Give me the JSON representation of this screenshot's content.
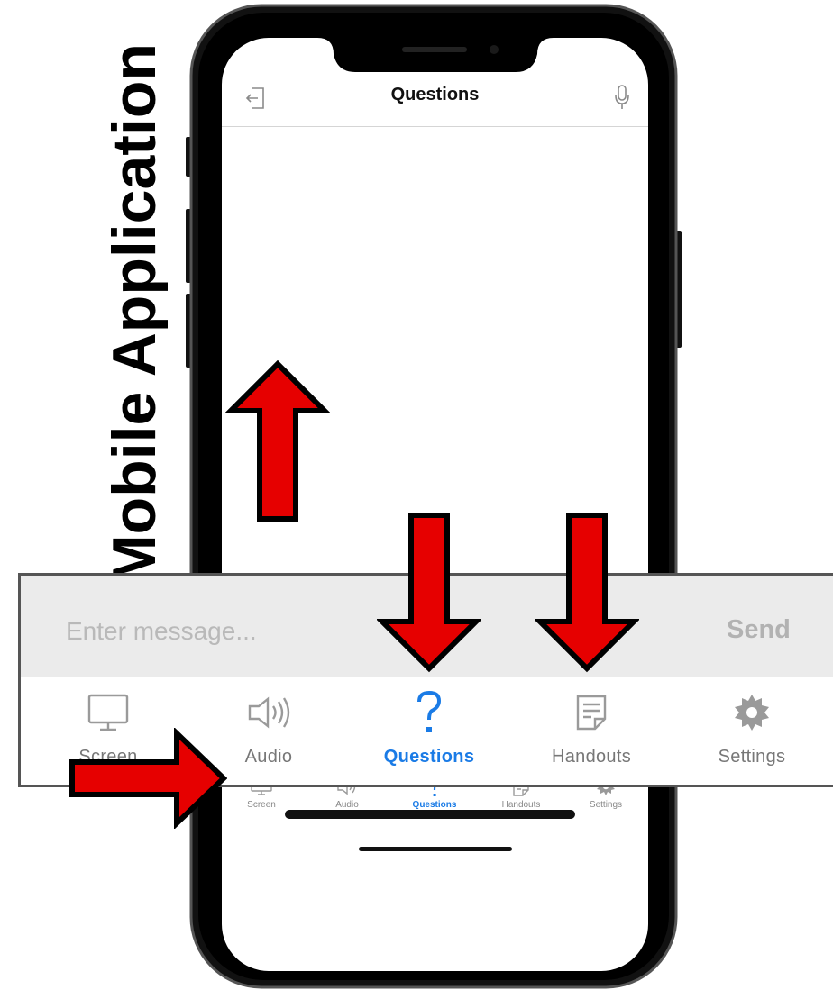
{
  "side_title": "Mobile Application",
  "app": {
    "title": "Questions",
    "header_left_icon": "exit-icon",
    "header_right_icon": "microphone-icon"
  },
  "composer": {
    "placeholder": "Enter message...",
    "send_label": "Send"
  },
  "tabs": [
    {
      "label": "Screen",
      "icon": "monitor-icon",
      "active": false
    },
    {
      "label": "Audio",
      "icon": "speaker-icon",
      "active": false
    },
    {
      "label": "Questions",
      "icon": "question-mark-icon",
      "active": true
    },
    {
      "label": "Handouts",
      "icon": "document-icon",
      "active": false
    },
    {
      "label": "Settings",
      "icon": "gear-icon",
      "active": false
    }
  ],
  "colors": {
    "active_tab": "#1a7be6",
    "inactive_tab": "#777777",
    "arrow_fill": "#e60000",
    "arrow_outline": "#000000",
    "composer_bg": "#ebebeb"
  },
  "annotation_arrows": [
    {
      "name": "arrow-up-to-message-area",
      "direction": "up"
    },
    {
      "name": "arrow-down-to-questions-tab",
      "direction": "down"
    },
    {
      "name": "arrow-down-to-handouts-tab",
      "direction": "down"
    },
    {
      "name": "arrow-right-to-message-input",
      "direction": "right"
    }
  ]
}
